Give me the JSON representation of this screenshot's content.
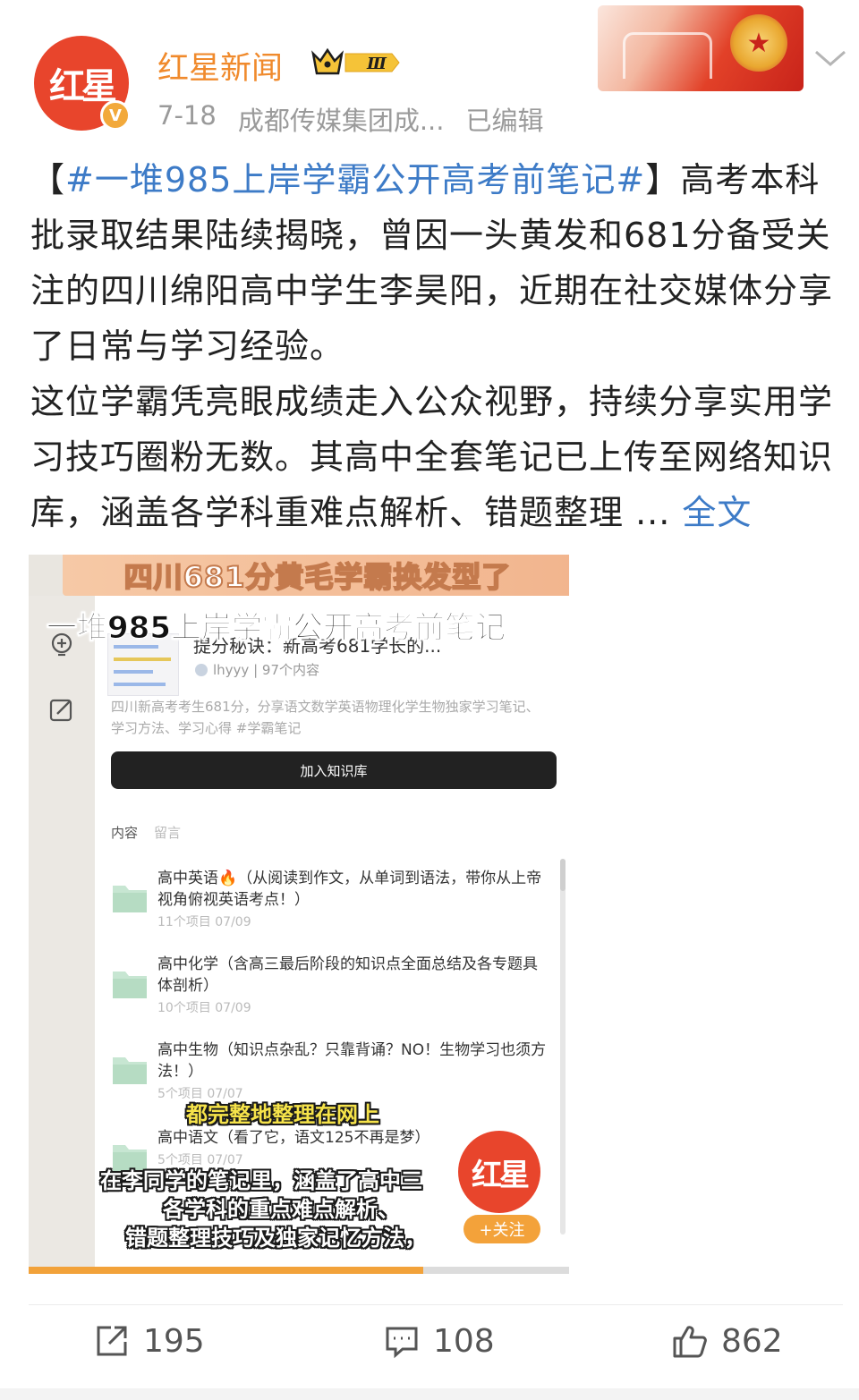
{
  "header": {
    "avatar_text": "红星",
    "verified_mark": "V",
    "username": "红星新闻",
    "badge_text": "Ⅲ",
    "date": "7-18",
    "source": "成都传媒集团成...",
    "edited": "已编辑"
  },
  "post": {
    "open_bracket": "【",
    "hashtag": "#一堆985上岸学霸公开高考前笔记#",
    "close_bracket": "】",
    "para1_rest": "高考本科批录取结果陆续揭晓，曾因一头黄发和681分备受关注的四川绵阳高中学生李昊阳，近期在社交媒体分享了日常与学习经验。",
    "para2": "这位学霸凭亮眼成绩走入公众视野，持续分享实用学习技巧圈粉无数。其高中全套笔记已上传至网络知识库，涵盖各学科重难点解析、错题整理 ...",
    "full_text_link": "全文"
  },
  "video": {
    "top_banner": "四川681分黄毛学霸换发型了",
    "title_overlay": "一堆985上岸学霸公开高考前笔记",
    "clipped_title": "提分秘诀：新高考681学长的...",
    "author": "lhyyy | 97个内容",
    "description": "四川新高考考生681分，分享语文数学英语物理化学生物独家学习笔记、学习方法、学习心得 #学霸笔记",
    "join_button": "加入知识库",
    "tabs": [
      "内容",
      "留言"
    ],
    "folders": [
      {
        "title": "高中英语🔥（从阅读到作文，从单词到语法，带你从上帝视角俯视英语考点！）",
        "meta": "11个项目  07/09"
      },
      {
        "title": "高中化学（含高三最后阶段的知识点全面总结及各专题具体剖析）",
        "meta": "10个项目  07/09"
      },
      {
        "title": "高中生物（知识点杂乱？只靠背诵？NO！生物学习也须方法！）",
        "meta": "5个项目  07/07"
      },
      {
        "title": "高中语文（看了它，语文125不再是梦）",
        "meta": "5个项目  07/07"
      }
    ],
    "subtitle_yellow": "都完整地整理在网上",
    "subtitle_1": "在李同学的笔记里，涵盖了高中三",
    "subtitle_2": "各学科的重点难点解析、",
    "subtitle_3": "错题整理技巧及独家记忆方法，",
    "logo_text": "红星",
    "follow_label": "+关注",
    "progress": 0.73
  },
  "actions": {
    "share_count": "195",
    "comment_count": "108",
    "like_count": "862"
  },
  "colors": {
    "brand_orange": "#f08a2c",
    "link_blue": "#3d7bc7",
    "logo_red": "#e8452c",
    "progress_orange": "#f2a23a"
  },
  "icons": [
    "chevron-down-icon",
    "crown-badge-icon",
    "share-icon",
    "comment-icon",
    "like-icon",
    "folder-icon",
    "lightbulb-icon",
    "edit-icon"
  ]
}
